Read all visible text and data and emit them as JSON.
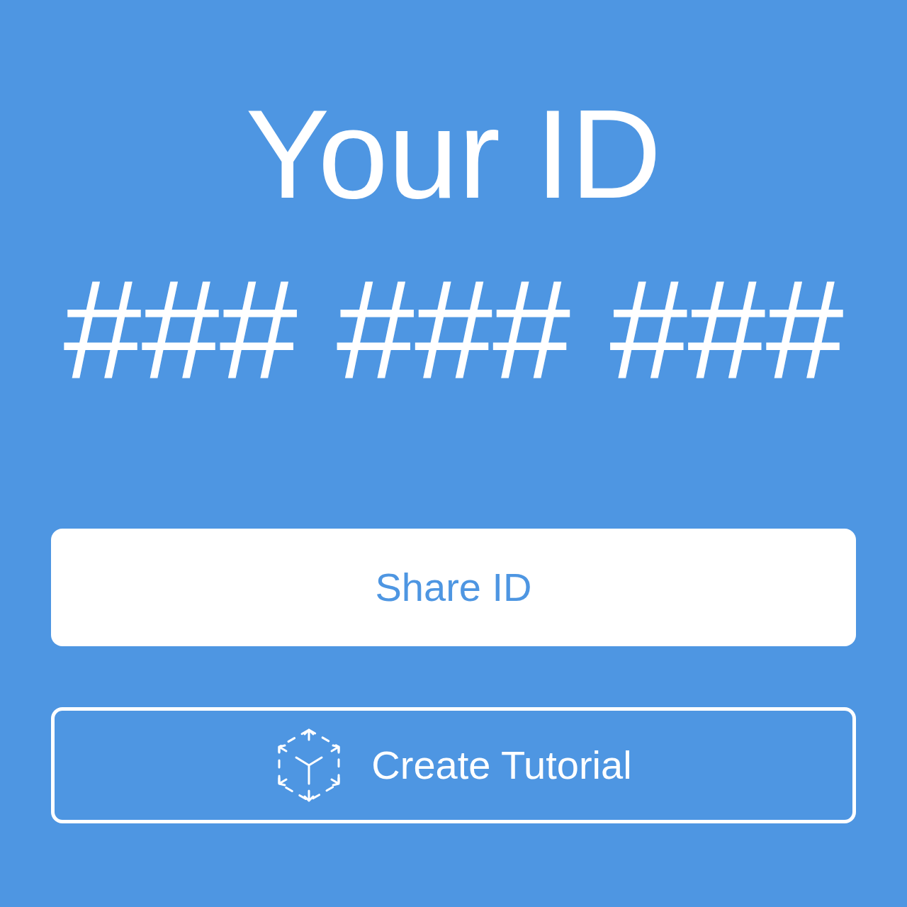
{
  "title": "Your ID",
  "id_code": "### ### ###",
  "buttons": [
    {
      "kind": "filled",
      "label": "Share ID"
    },
    {
      "kind": "outlined",
      "label": "Create Tutorial"
    }
  ]
}
